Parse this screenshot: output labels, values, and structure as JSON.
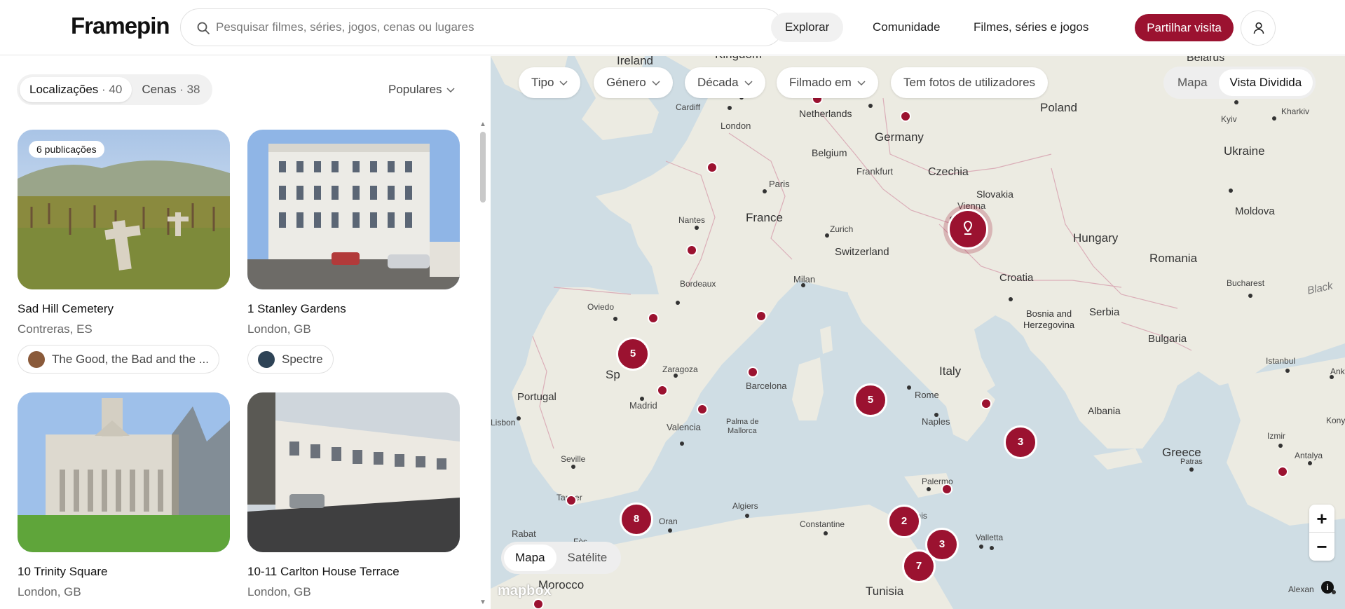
{
  "header": {
    "logo": "Framepin",
    "search_placeholder": "Pesquisar filmes, séries, jogos, cenas ou lugares",
    "nav": [
      "Explorar",
      "Comunidade",
      "Filmes, séries e jogos"
    ],
    "cta": "Partilhar visita"
  },
  "list": {
    "tabs": [
      {
        "label": "Localizações",
        "count": "· 40"
      },
      {
        "label": "Cenas",
        "count": "· 38"
      }
    ],
    "sort": "Populares",
    "cards": [
      {
        "title": "Sad Hill Cemetery",
        "location": "Contreras, ES",
        "badge": "6 publicações",
        "chip": "The Good, the Bad and the ..."
      },
      {
        "title": "1 Stanley Gardens",
        "location": "London, GB",
        "badge": "",
        "chip": "Spectre"
      },
      {
        "title": "10 Trinity Square",
        "location": "London, GB",
        "badge": "",
        "chip": ""
      },
      {
        "title": "10-11 Carlton House Terrace",
        "location": "London, GB",
        "badge": "",
        "chip": ""
      }
    ]
  },
  "map": {
    "filters": [
      "Tipo",
      "Género",
      "Década",
      "Filmado em",
      "Tem fotos de utilizadores"
    ],
    "view_modes": [
      "Mapa",
      "Vista Dividida"
    ],
    "layer_modes": [
      "Mapa",
      "Satélite"
    ],
    "zoom_in": "+",
    "zoom_out": "−",
    "attribution": "mapbox",
    "labels": {
      "countries": [
        "Ireland",
        "Kingdom",
        "Netherlands",
        "Germany",
        "Belgium",
        "Poland",
        "Belarus",
        "Ukraine",
        "Czechia",
        "Slovakia",
        "France",
        "Switzerland",
        "Hungary",
        "Moldova",
        "Romania",
        "Croatia",
        "Bosnia and",
        "Herzegovina",
        "Serbia",
        "Bulgaria",
        "Italy",
        "Portugal",
        "Sp",
        "Albania",
        "Greece",
        "Morocco",
        "Tunisia",
        "Black"
      ],
      "cities": [
        "Cardiff",
        "London",
        "Paris",
        "Frankfurt",
        "Kyiv",
        "Kharkiv",
        "Vienna",
        "Nantes",
        "Zurich",
        "Milan",
        "Bordeaux",
        "Bucharest",
        "Oviedo",
        "Zaragoza",
        "Barcelona",
        "Madrid",
        "Valencia",
        "Palma de",
        "Mallorca",
        "Lisbon",
        "Rome",
        "Naples",
        "Istanbul",
        "Ankar",
        "Izmir",
        "Antalya",
        "Seville",
        "Patras",
        "Palermo",
        "Algiers",
        "Constantine",
        "Oran",
        "Tanger",
        "Rabat",
        "Fès",
        "Tunis",
        "Valletta",
        "Alexan",
        "Kony"
      ]
    },
    "clusters": [
      "5",
      "5",
      "3",
      "8",
      "2",
      "3",
      "7"
    ],
    "colors": {
      "marker": "#9b1230",
      "land": "#ecebe2",
      "sea": "#cfdde4"
    }
  }
}
